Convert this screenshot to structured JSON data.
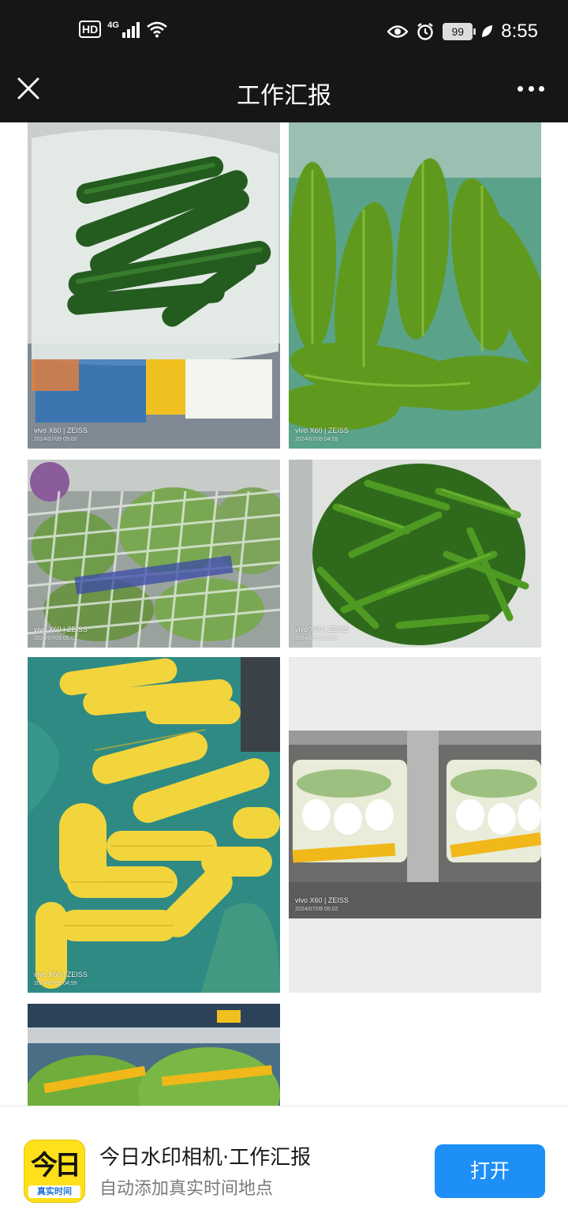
{
  "status_bar": {
    "hd": "HD",
    "network": "4G",
    "battery": "99",
    "time": "8:55"
  },
  "nav": {
    "title": "工作汇报"
  },
  "photos": [
    {
      "alt": "cucumber",
      "wm_brand": "vivo X60 | ZEISS",
      "wm_date": "2024/07/09 05:00"
    },
    {
      "alt": "bitter melon",
      "wm_brand": "vivo X60 | ZEISS",
      "wm_date": "2024/07/09 04:59"
    },
    {
      "alt": "cabbage",
      "wm_brand": "vivo X60 | ZEISS",
      "wm_date": "2024/07/09 05:01"
    },
    {
      "alt": "green pepper",
      "wm_brand": "vivo X60 | ZEISS",
      "wm_date": "2024/07/09 04:59"
    },
    {
      "alt": "corn",
      "wm_brand": "vivo X60 | ZEISS",
      "wm_date": "2024/07/09 04:59"
    },
    {
      "alt": "bok choy",
      "wm_brand": "vivo X60 | ZEISS",
      "wm_date": "2024/07/09 05:02"
    },
    {
      "alt": "lettuce",
      "wm_brand": "",
      "wm_date": ""
    }
  ],
  "footer": {
    "icon_big": "今日",
    "icon_strip": "真实时间",
    "app_name": "今日水印相机·工作汇报",
    "app_sub": "自动添加真实时间地点",
    "open_label": "打开"
  },
  "colors": {
    "bar_bg": "#161616",
    "accent": "#1e8ff7",
    "icon_yellow": "#ffe01a"
  }
}
